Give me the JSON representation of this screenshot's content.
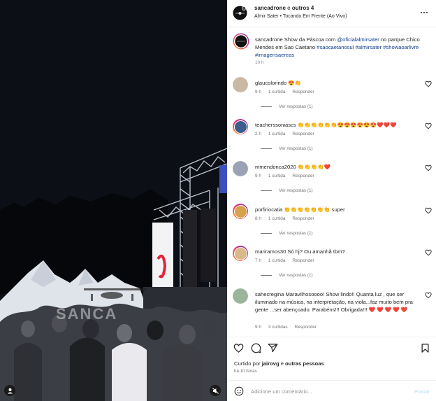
{
  "media": {
    "watermark": "SANCA",
    "user_icon": "person-icon",
    "mute_icon": "muted-speaker-icon"
  },
  "header": {
    "username": "sancadrone",
    "connector": " e ",
    "others": "outros 4",
    "subtitle": "Almir Sater • Tocando Em Frente (Ao Vivo)",
    "more_icon": "more-horizontal-icon"
  },
  "caption": {
    "username": "sancadrone",
    "text_before": " Show da Páscoa com ",
    "mention": "@oficialalmirsater",
    "text_after": " no parque Chico Mendes em Sao Caetano ",
    "tags": "#saocaetanosul #almirsater #showaoarlivre #imagensaereas",
    "time": "10 h"
  },
  "comments": [
    {
      "username": "glaucolorindo",
      "text": " 😍👏",
      "time": "9 h",
      "likes": "1 curtida",
      "reply": "Responder",
      "replies": "Ver respostas (1)",
      "avatar_color": "#c9b9a3"
    },
    {
      "username": "teacherssoniascs",
      "text": " 👏👏👏👏👏👏😍😍😍😍😍😍❤️❤️❤️",
      "time": "2 h",
      "likes": "1 curtida",
      "reply": "Responder",
      "replies": "Ver respostas (1)",
      "avatar_color": "#3b5e8f"
    },
    {
      "username": "mmendonca2020",
      "text": " 👏👏👏👏❤️",
      "time": "9 h",
      "likes": "1 curtida",
      "reply": "Responder",
      "replies": "Ver respostas (1)",
      "avatar_color": "#9aa2b3"
    },
    {
      "username": "porfiriocatia",
      "text": " 👏👏👏👏👏👏👏 super",
      "time": "8 h",
      "likes": "1 curtida",
      "reply": "Responder",
      "replies": "Ver respostas (1)",
      "avatar_color": "#d7a24c"
    },
    {
      "username": "mariramos30",
      "text": " Só hj? Ou amanhã tbm?",
      "time": "7 h",
      "likes": "1 curtida",
      "reply": "Responder",
      "replies": "Ver respostas (1)",
      "avatar_color": "#d9b98a"
    },
    {
      "username": "sahecregina",
      "text": " Maravilhosoooo! Show lindo!! Quanta luz , que ser iluminado na música, na interpretação, na viola...faz muito bem pra gente ...ser abençoado. Parabéns!!! Obrigada!!! ❤️ ❤️ ❤️ ❤️ ❤️",
      "time": "9 h",
      "likes": "3 curtidas",
      "reply": "Responder",
      "avatar_color": "#9bb59a"
    }
  ],
  "actions": {
    "like_icon": "heart-icon",
    "comment_icon": "comment-bubble-icon",
    "share_icon": "send-paper-plane-icon",
    "save_icon": "bookmark-icon",
    "liked_prefix": "Curtido por ",
    "liked_user": "jairovg",
    "liked_mid": " e ",
    "liked_others": "outras pessoas",
    "time_ago": "há 10 horas"
  },
  "add_comment": {
    "emoji_icon": "smiley-face-icon",
    "placeholder": "Adicione um comentário...",
    "post_label": "Postar"
  }
}
